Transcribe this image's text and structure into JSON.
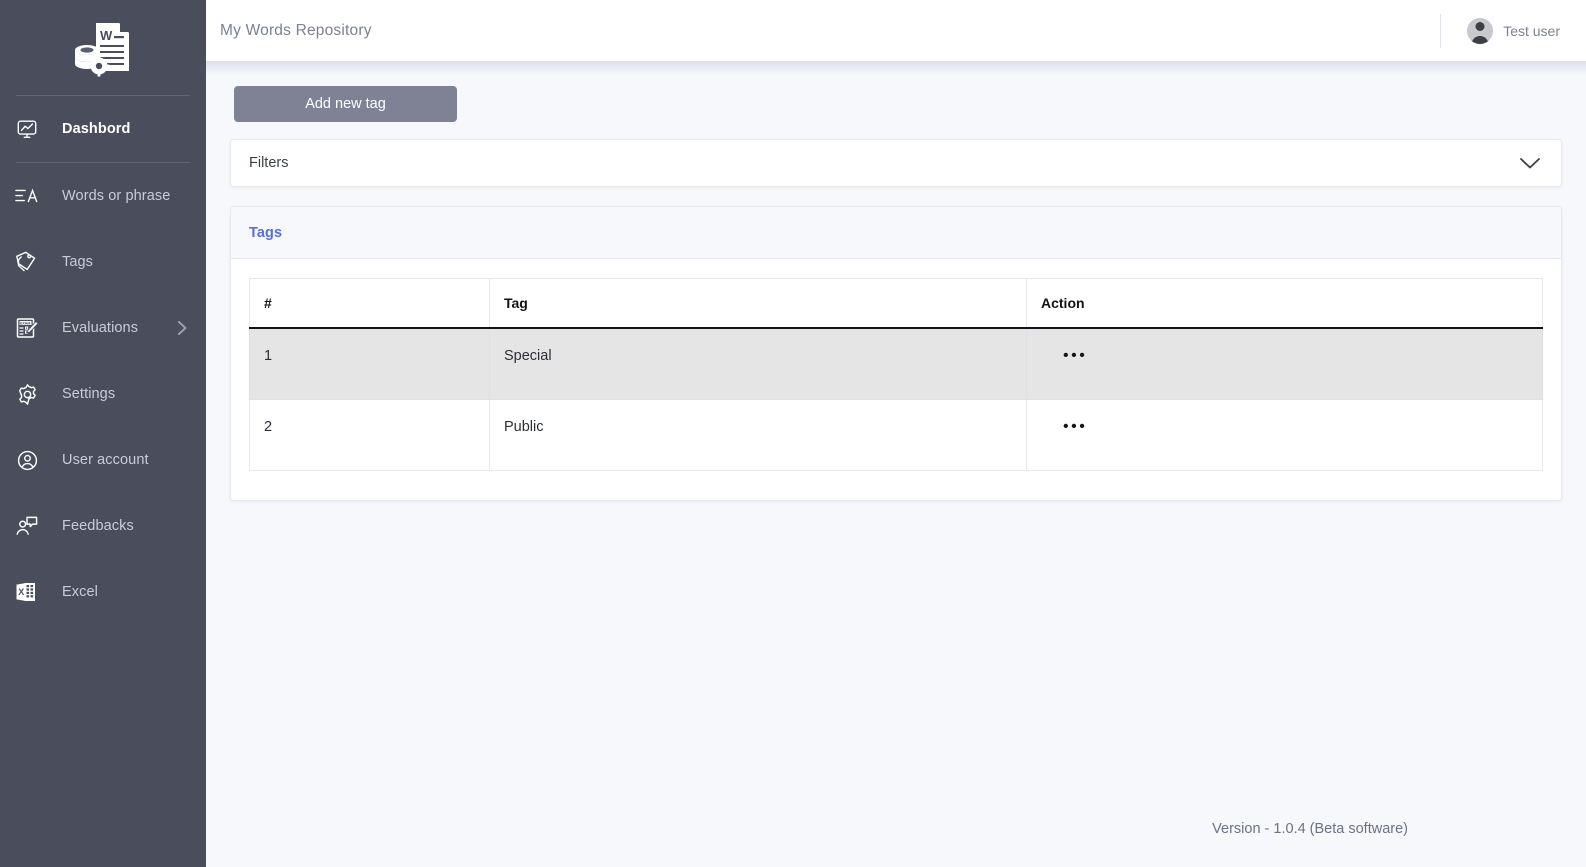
{
  "app": {
    "logo_icon": "document-database-gear-icon",
    "version_text": "Version - 1.0.4 (Beta software)"
  },
  "sidebar": {
    "items": [
      {
        "label": "Dashbord",
        "icon": "monitor-chart-icon",
        "active": true,
        "has_chevron": false
      },
      {
        "label": "Words or phrase",
        "icon": "text-lines-a-icon",
        "active": false,
        "has_chevron": false
      },
      {
        "label": "Tags",
        "icon": "tags-icon",
        "active": false,
        "has_chevron": false
      },
      {
        "label": "Evaluations",
        "icon": "exam-clipboard-icon",
        "active": false,
        "has_chevron": true
      },
      {
        "label": "Settings",
        "icon": "gear-icon",
        "active": false,
        "has_chevron": false
      },
      {
        "label": "User account",
        "icon": "user-circle-icon",
        "active": false,
        "has_chevron": false
      },
      {
        "label": "Feedbacks",
        "icon": "user-speech-bubble-icon",
        "active": false,
        "has_chevron": false
      },
      {
        "label": "Excel",
        "icon": "excel-file-icon",
        "active": false,
        "has_chevron": false
      }
    ]
  },
  "header": {
    "title": "My Words Repository",
    "user_name": "Test user",
    "avatar_icon": "user-avatar-icon"
  },
  "toolbar": {
    "add_tag_label": "Add new tag"
  },
  "filters": {
    "label": "Filters",
    "chevron_icon": "chevron-down-icon",
    "expanded": false
  },
  "tags_card": {
    "title": "Tags",
    "table": {
      "columns": [
        "#",
        "Tag",
        "Action"
      ],
      "rows": [
        {
          "num": "1",
          "tag": "Special",
          "action": "•••",
          "highlighted": true
        },
        {
          "num": "2",
          "tag": "Public",
          "action": "•••",
          "highlighted": false
        }
      ]
    }
  },
  "colors": {
    "sidebar_bg": "#4a4e5c",
    "page_bg": "#f7f8fc",
    "accent_blue": "#5a6fd6",
    "button_gray": "#7f8295",
    "row_highlight": "#e5e5e5"
  }
}
